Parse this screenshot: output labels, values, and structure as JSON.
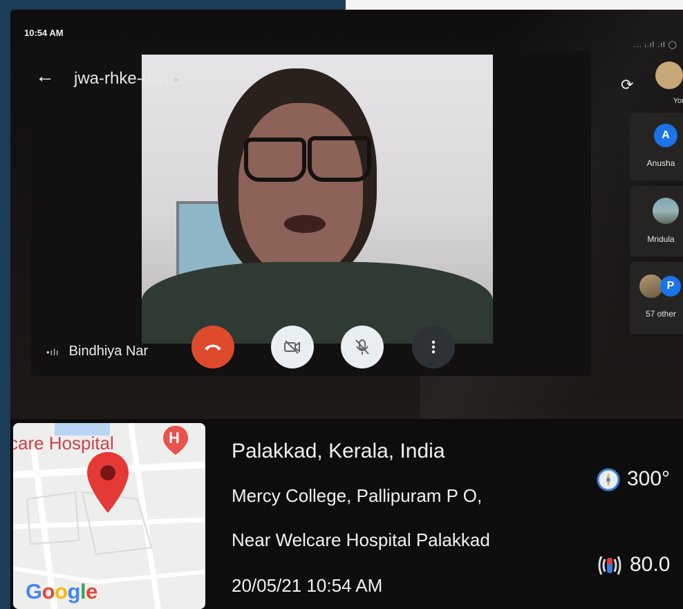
{
  "status_bar": {
    "time": "10:54 AM",
    "icons_text": "... ᵢ.ıl .ıl ◯"
  },
  "meeting": {
    "code": "jwa-rhke-dcn",
    "chevron": "▸",
    "back_icon": "←",
    "speaker_name": "Bindhiya Nar"
  },
  "controls": {
    "hangup": "end-call-icon",
    "camera": "camera-off-icon",
    "mic": "mic-off-icon",
    "more": "more-vert-icon",
    "hangup_color": "#e04a2c",
    "toggle_color": "#e9eef2"
  },
  "participants": [
    {
      "label": "You"
    },
    {
      "label": "Anusha",
      "initial": "A",
      "color": "#1a73e8"
    },
    {
      "label": "Mridula"
    },
    {
      "label": "57 other",
      "initial": "P",
      "color": "#1a73e8"
    }
  ],
  "map": {
    "label": "care Hospital",
    "marker_letter": "H",
    "logo": {
      "G": "G",
      "o1": "o",
      "o2": "o",
      "g": "g",
      "l": "l",
      "e": "e"
    }
  },
  "location": {
    "title": "Palakkad, Kerala, India",
    "address_line1": "Mercy College, Pallipuram P O,",
    "address_line2": "Near Welcare Hospital Palakkad",
    "datetime": "20/05/21 10:54 AM"
  },
  "sensors": {
    "compass_value": "300°",
    "magnetic_value": "80.0"
  }
}
